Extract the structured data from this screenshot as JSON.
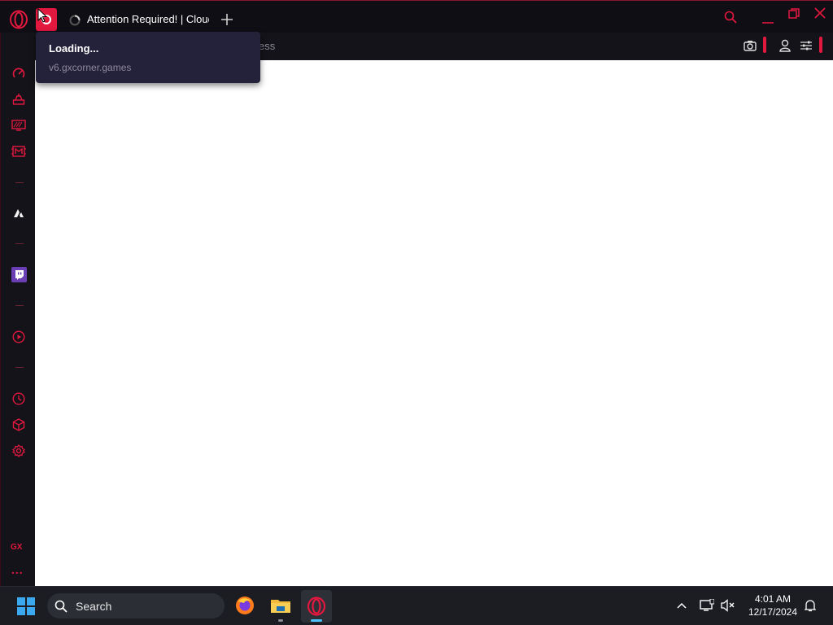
{
  "browser": {
    "active_tab": {
      "title": "Attention Required! | Cloudflare"
    },
    "address_placeholder_fragment": "ess",
    "tooltip": {
      "status": "Loading...",
      "url": "v6.gxcorner.games"
    }
  },
  "sidebar": {
    "items": [
      {
        "name": "speed-dial-icon"
      },
      {
        "name": "gx-control-icon"
      },
      {
        "name": "gx-cleaner-icon"
      },
      {
        "name": "gx-corner-icon"
      },
      {
        "name": "aria-icon"
      },
      {
        "name": "twitch-icon"
      },
      {
        "name": "player-icon"
      },
      {
        "name": "history-icon"
      },
      {
        "name": "extensions-icon"
      },
      {
        "name": "settings-icon"
      }
    ],
    "gx_label": "GX",
    "more_label": "..."
  },
  "taskbar": {
    "search_placeholder": "Search",
    "clock": {
      "time": "4:01 AM",
      "date": "12/17/2024"
    }
  },
  "colors": {
    "accent": "#e2183f",
    "bar_bg": "#0f0e14",
    "sidebar_bg": "#141319",
    "tooltip_bg": "#24213a",
    "taskbar_bg": "#1b1d23"
  }
}
